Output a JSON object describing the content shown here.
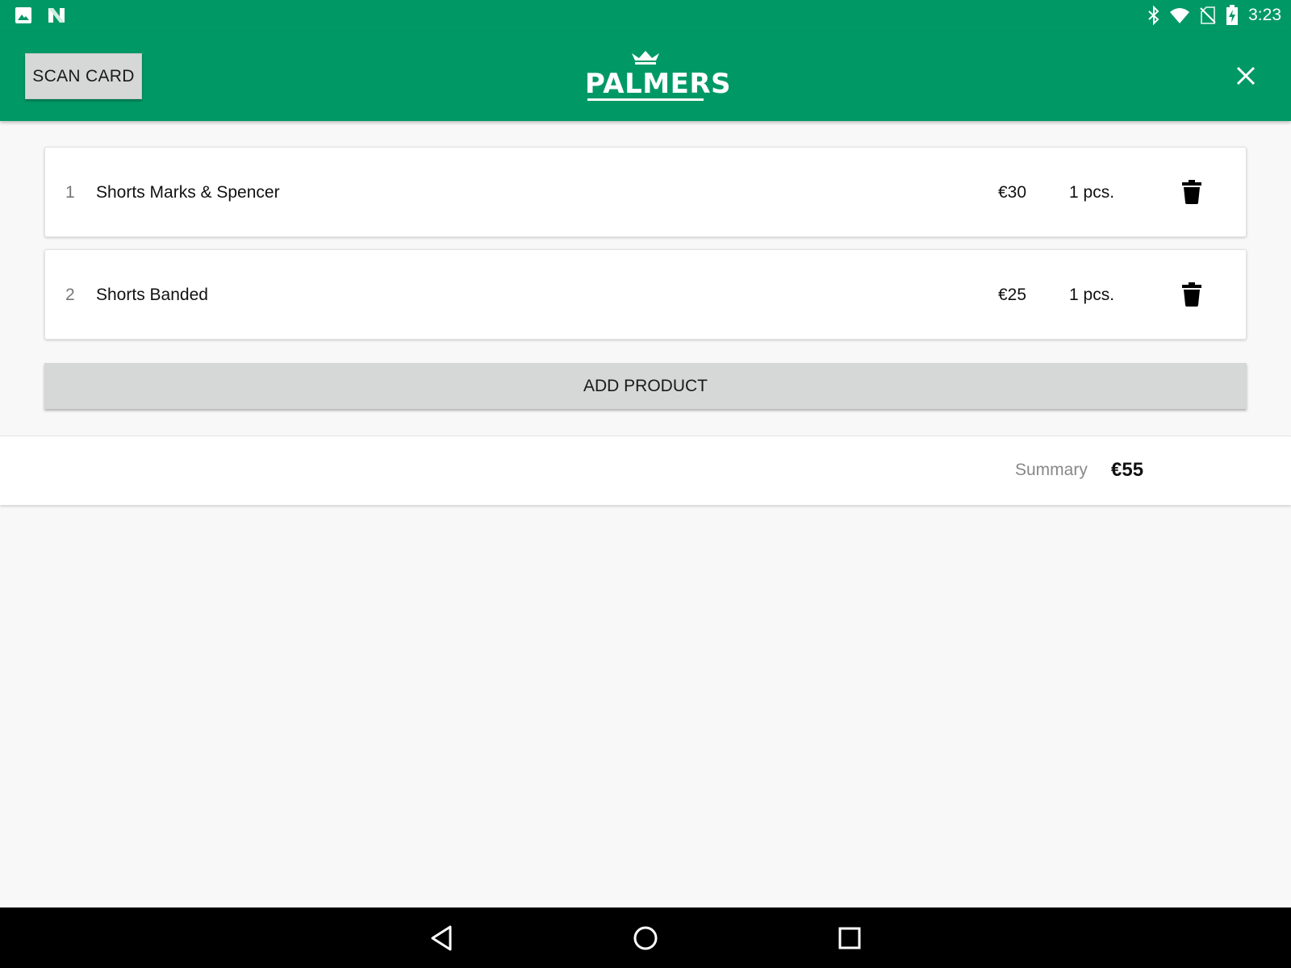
{
  "status_bar": {
    "time": "3:23",
    "left_icons": [
      "image-notification-icon",
      "n-notification-icon"
    ],
    "right_icons": [
      "bluetooth-icon",
      "wifi-icon",
      "no-sim-icon",
      "battery-charging-icon"
    ]
  },
  "app_bar": {
    "scan_card_label": "SCAN CARD",
    "logo_text": "PALMERS",
    "background_color": "#009966"
  },
  "items": [
    {
      "index": "1",
      "name": "Shorts Marks & Spencer",
      "price": "€30",
      "quantity": "1 pcs."
    },
    {
      "index": "2",
      "name": "Shorts Banded",
      "price": "€25",
      "quantity": "1 pcs."
    }
  ],
  "add_product_label": "ADD PRODUCT",
  "summary": {
    "label": "Summary",
    "total": "€55"
  },
  "nav_bar": {
    "buttons": [
      "back-icon",
      "home-icon",
      "recents-icon"
    ]
  }
}
